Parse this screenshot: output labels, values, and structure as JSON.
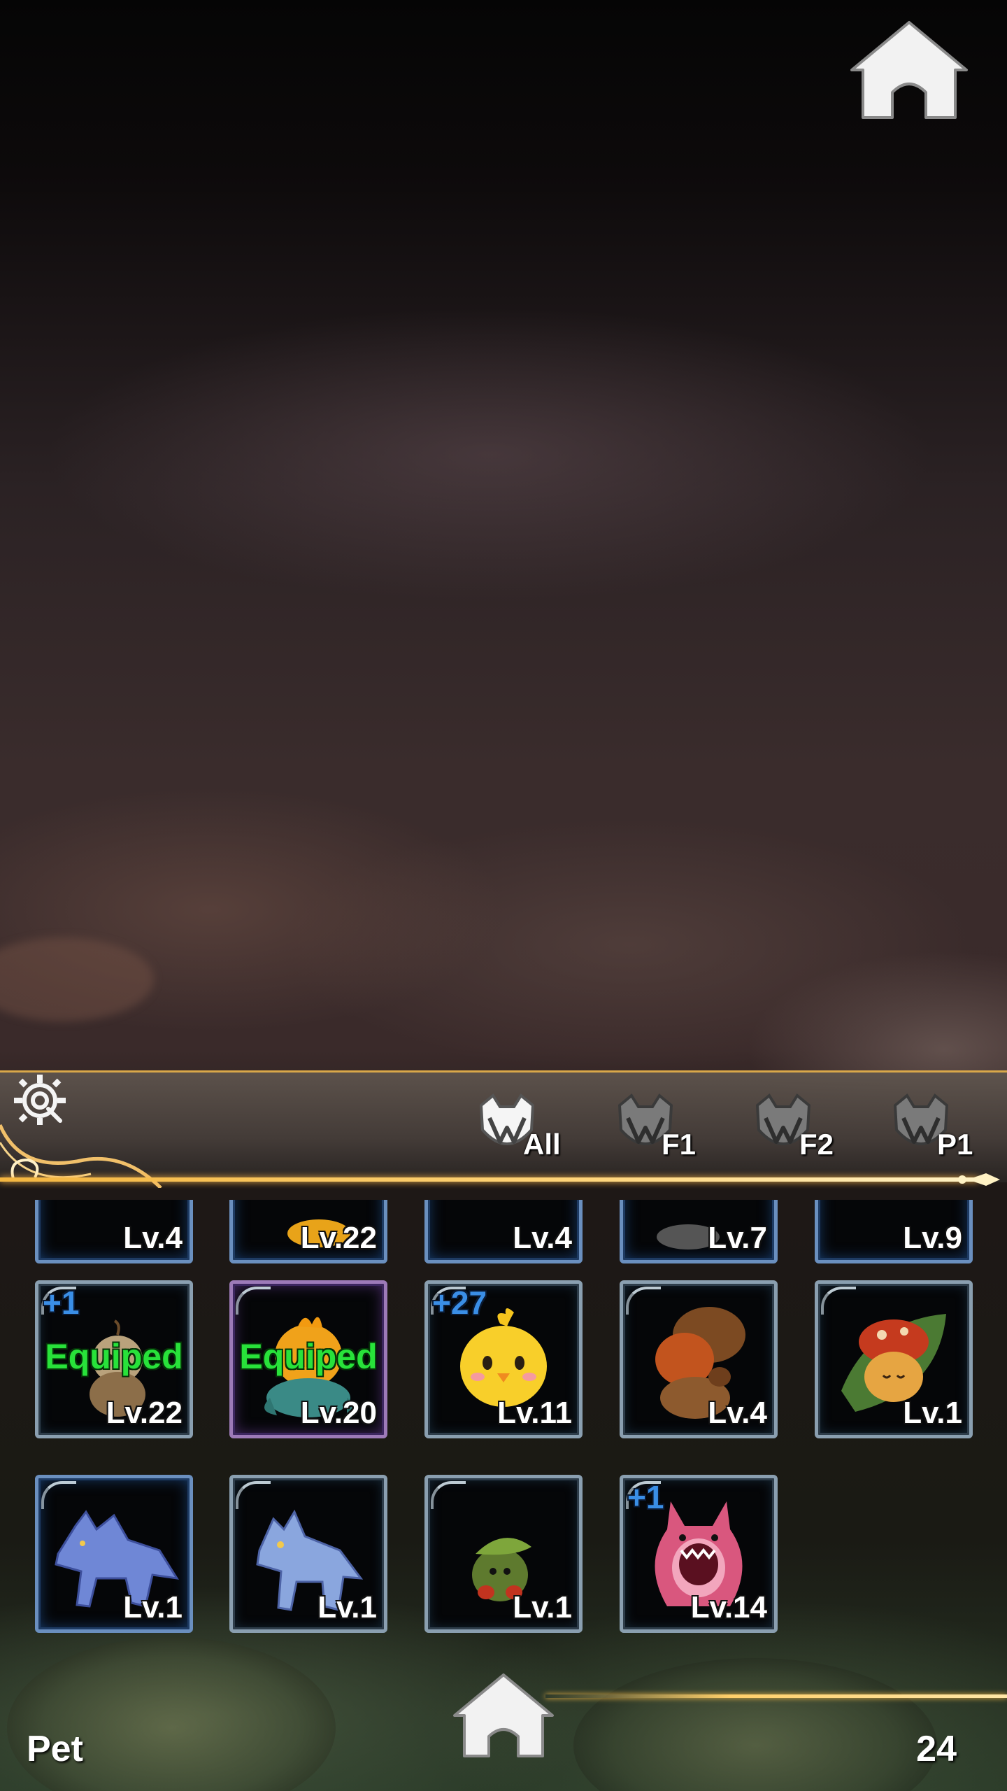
{
  "header": {
    "home_icon": "home-icon"
  },
  "filter_bar": {
    "settings_icon": "gear-search-icon",
    "tabs": [
      {
        "label": "All",
        "icon": "pet-paw-icon",
        "selected": true
      },
      {
        "label": "F1",
        "icon": "pet-paw-icon",
        "selected": false
      },
      {
        "label": "F2",
        "icon": "pet-paw-icon",
        "selected": false
      },
      {
        "label": "P1",
        "icon": "pet-paw-icon",
        "selected": false
      }
    ]
  },
  "pets": {
    "row0": [
      {
        "level": "Lv.4"
      },
      {
        "level": "Lv.22"
      },
      {
        "level": "Lv.4"
      },
      {
        "level": "Lv.7"
      },
      {
        "level": "Lv.9"
      }
    ],
    "row1": [
      {
        "level": "Lv.22",
        "plus": "+1",
        "status": "Equiped",
        "creature": "scarecrow-pet"
      },
      {
        "level": "Lv.20",
        "status": "Equiped",
        "creature": "orange-bird-pet"
      },
      {
        "level": "Lv.11",
        "plus": "+27",
        "creature": "yellow-chick-pet"
      },
      {
        "level": "Lv.4",
        "creature": "brown-mushroom-pet"
      },
      {
        "level": "Lv.1",
        "creature": "leaf-mushroom-pet"
      }
    ],
    "row2": [
      {
        "level": "Lv.1",
        "creature": "blue-wolf-pet"
      },
      {
        "level": "Lv.1",
        "creature": "blue-wolf-pup-pet"
      },
      {
        "level": "Lv.1",
        "creature": "leaf-bug-pet"
      },
      {
        "level": "Lv.14",
        "plus": "+1",
        "creature": "pink-monster-pet"
      }
    ]
  },
  "footer": {
    "title": "Pet",
    "count": "24",
    "home_icon": "home-icon"
  },
  "colors": {
    "accent_gold": "#f4b640",
    "equiped_green": "#28e23a",
    "plus_blue": "#3a8ee6"
  }
}
